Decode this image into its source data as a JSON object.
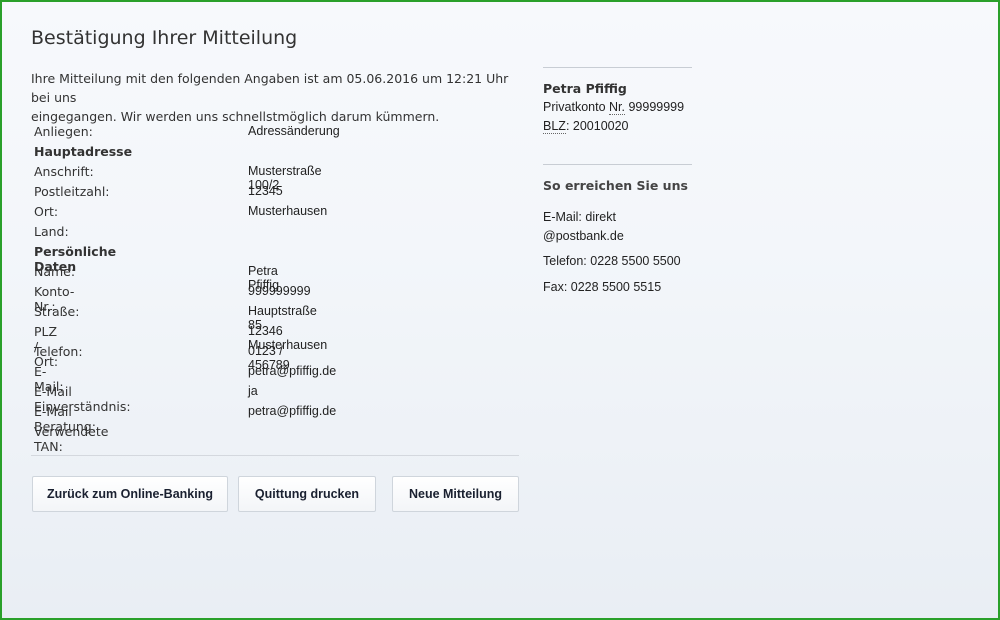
{
  "page": {
    "title": "Bestätigung Ihrer Mitteilung",
    "intro_line1": "Ihre Mitteilung mit den folgenden Angaben ist am 05.06.2016 um 12:21 Uhr bei uns",
    "intro_line2": "eingegangen. Wir werden uns schnellstmöglich darum kümmern."
  },
  "details": [
    {
      "label": "Anliegen:",
      "value": "Adressänderung"
    },
    {
      "label": "Hauptadresse",
      "value": "",
      "section": true
    },
    {
      "label": "Anschrift:",
      "value": "Musterstraße 100/2"
    },
    {
      "label": "Postleitzahl:",
      "value": "12345"
    },
    {
      "label": "Ort:",
      "value": "Musterhausen"
    },
    {
      "label": "Land:",
      "value": ""
    },
    {
      "label": "Persönliche Daten",
      "value": "",
      "section": true
    },
    {
      "label": "Name:",
      "value": "Petra Pfiffig"
    },
    {
      "label": "Konto-Nr.:",
      "value": "999999999"
    },
    {
      "label": "Straße:",
      "value": "Hauptstraße 85"
    },
    {
      "label": "PLZ / Ort:",
      "value": "12346 Musterhausen"
    },
    {
      "label": "Telefon:",
      "value": "0123 / 456789"
    },
    {
      "label": "E-Mail:",
      "value": "petra@pfiffig.de"
    },
    {
      "label": "E-Mail Einverständnis:",
      "value": "ja"
    },
    {
      "label": "E-Mail Beratung:",
      "value": "petra@pfiffig.de"
    },
    {
      "label": "Verwendete TAN:",
      "value": ""
    }
  ],
  "buttons": {
    "back": "Zurück zum Online-Banking",
    "print": "Quittung drucken",
    "new": "Neue Mitteilung"
  },
  "account": {
    "name": "Petra Pfiffig",
    "konto_prefix": "Privatkonto ",
    "konto_abbr": "Nr.",
    "konto_number": " 99999999",
    "blz_abbr": "BLZ",
    "blz_value": ": 20010020"
  },
  "contact": {
    "heading": "So erreichen Sie uns",
    "email_line1": "E-Mail: direkt",
    "email_line2": "@postbank.de",
    "phone": "Telefon: 0228 5500 5500",
    "fax": "Fax: 0228 5500 5515"
  },
  "colors": {
    "frame_border": "#2aa02a",
    "background": "#f3f6fa"
  }
}
